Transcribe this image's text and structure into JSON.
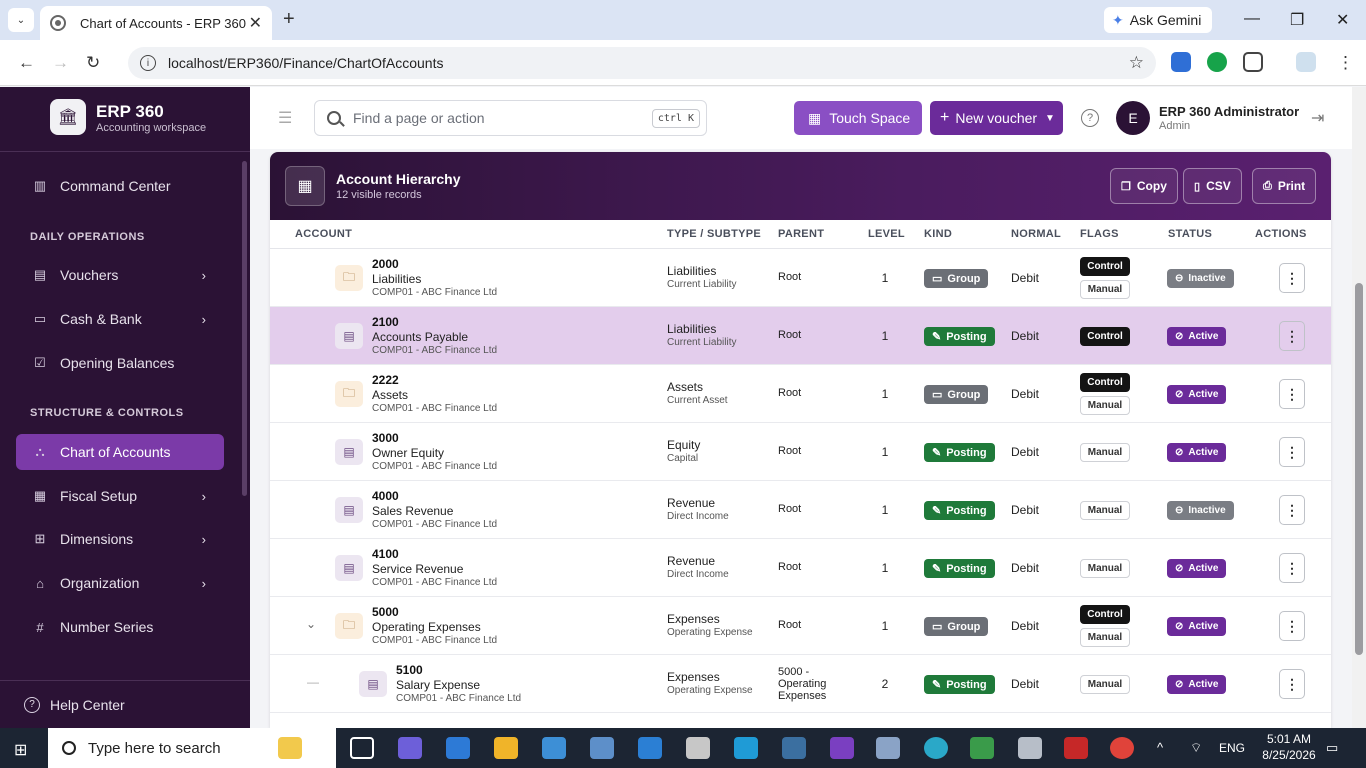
{
  "browser": {
    "tab_title": "Chart of Accounts - ERP 360",
    "url": "localhost/ERP360/Finance/ChartOfAccounts",
    "gemini_label": "Ask Gemini"
  },
  "brand": {
    "name": "ERP 360",
    "subtitle": "Accounting workspace"
  },
  "sidebar": {
    "top_item": "Command Center",
    "sections": [
      {
        "heading": "DAILY OPERATIONS"
      },
      {
        "heading": "STRUCTURE & CONTROLS"
      }
    ],
    "items": [
      "Vouchers",
      "Cash & Bank",
      "Opening Balances",
      "Chart of Accounts",
      "Fiscal Setup",
      "Dimensions",
      "Organization",
      "Number Series"
    ],
    "help": "Help Center"
  },
  "topbar": {
    "search_placeholder": "Find a page or action",
    "shortcut": "ctrl K",
    "touch_label": "Touch Space",
    "new_voucher_label": "New voucher",
    "avatar_initial": "E",
    "user_name": "ERP 360 Administrator",
    "user_role": "Admin"
  },
  "card": {
    "title": "Account Hierarchy",
    "subtitle": "12 visible records",
    "copy": "Copy",
    "csv": "CSV",
    "print": "Print"
  },
  "columns": [
    "ACCOUNT",
    "TYPE / SUBTYPE",
    "PARENT",
    "LEVEL",
    "KIND",
    "NORMAL",
    "FLAGS",
    "STATUS",
    "ACTIONS"
  ],
  "rows": [
    {
      "code": "2000",
      "name": "Liabilities",
      "company": "COMP01 - ABC Finance Ltd",
      "type": "Liabilities",
      "subtype": "Current Liability",
      "parent": "Root",
      "level": "1",
      "kind": "Group",
      "normal": "Debit",
      "flags": [
        "Control",
        "Manual"
      ],
      "status": "Inactive"
    },
    {
      "code": "2100",
      "name": "Accounts Payable",
      "company": "COMP01 - ABC Finance Ltd",
      "type": "Liabilities",
      "subtype": "Current Liability",
      "parent": "Root",
      "level": "1",
      "kind": "Posting",
      "normal": "Debit",
      "flags": [
        "Control"
      ],
      "status": "Active"
    },
    {
      "code": "2222",
      "name": "Assets",
      "company": "COMP01 - ABC Finance Ltd",
      "type": "Assets",
      "subtype": "Current Asset",
      "parent": "Root",
      "level": "1",
      "kind": "Group",
      "normal": "Debit",
      "flags": [
        "Control",
        "Manual"
      ],
      "status": "Active"
    },
    {
      "code": "3000",
      "name": "Owner Equity",
      "company": "COMP01 - ABC Finance Ltd",
      "type": "Equity",
      "subtype": "Capital",
      "parent": "Root",
      "level": "1",
      "kind": "Posting",
      "normal": "Debit",
      "flags": [
        "Manual"
      ],
      "status": "Active"
    },
    {
      "code": "4000",
      "name": "Sales Revenue",
      "company": "COMP01 - ABC Finance Ltd",
      "type": "Revenue",
      "subtype": "Direct Income",
      "parent": "Root",
      "level": "1",
      "kind": "Posting",
      "normal": "Debit",
      "flags": [
        "Manual"
      ],
      "status": "Inactive"
    },
    {
      "code": "4100",
      "name": "Service Revenue",
      "company": "COMP01 - ABC Finance Ltd",
      "type": "Revenue",
      "subtype": "Direct Income",
      "parent": "Root",
      "level": "1",
      "kind": "Posting",
      "normal": "Debit",
      "flags": [
        "Manual"
      ],
      "status": "Active"
    },
    {
      "code": "5000",
      "name": "Operating Expenses",
      "company": "COMP01 - ABC Finance Ltd",
      "type": "Expenses",
      "subtype": "Operating Expense",
      "parent": "Root",
      "level": "1",
      "kind": "Group",
      "normal": "Debit",
      "flags": [
        "Control",
        "Manual"
      ],
      "status": "Active"
    },
    {
      "code": "5100",
      "name": "Salary Expense",
      "company": "COMP01 - ABC Finance Ltd",
      "type": "Expenses",
      "subtype": "Operating Expense",
      "parent": "5000 - Operating Expenses",
      "level": "2",
      "kind": "Posting",
      "normal": "Debit",
      "flags": [
        "Manual"
      ],
      "status": "Active"
    }
  ],
  "taskbar": {
    "search_placeholder": "Type here to search",
    "lang": "ENG",
    "time": "5:01 AM",
    "date": "8/25/2026"
  }
}
